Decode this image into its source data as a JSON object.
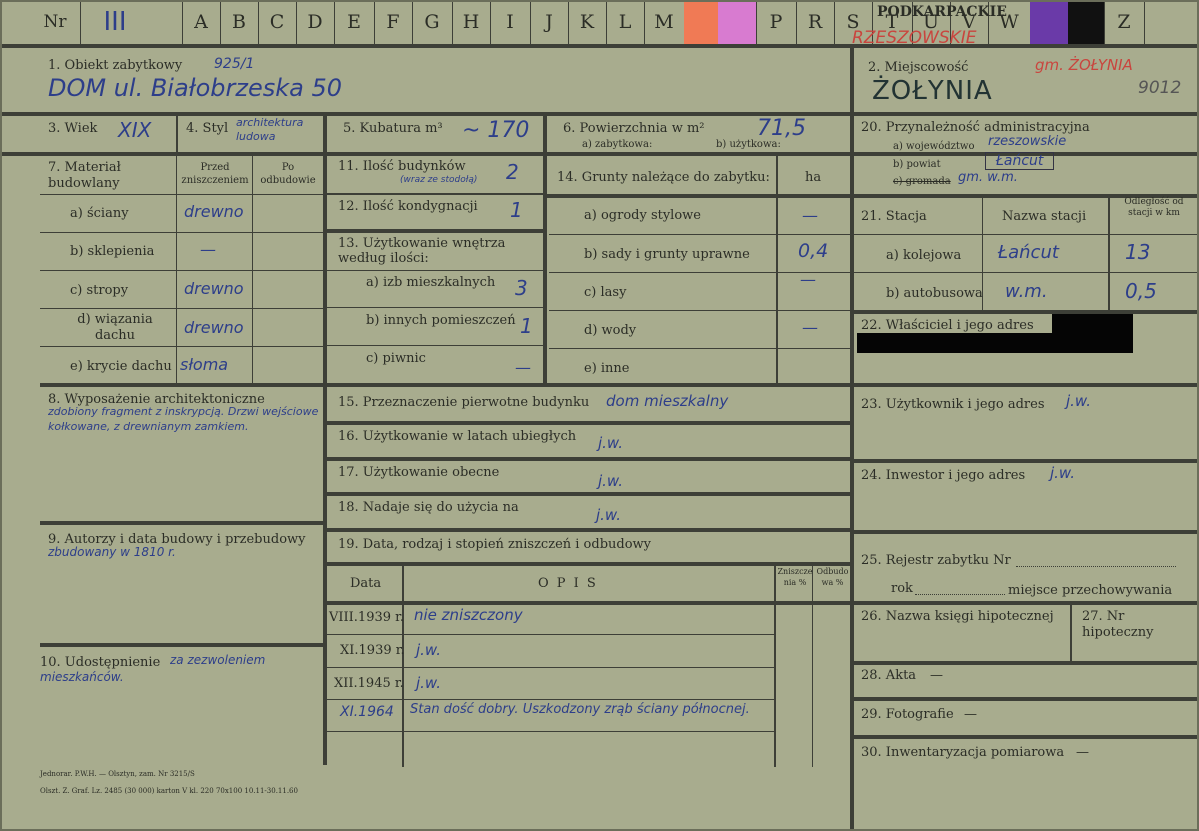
{
  "header": {
    "nr_label": "Nr",
    "nr_value": "III",
    "letters": [
      "A",
      "B",
      "C",
      "D",
      "E",
      "F",
      "G",
      "H",
      "I",
      "J",
      "K",
      "L",
      "M",
      "",
      "",
      "",
      "P",
      "R",
      "S",
      "T",
      "U",
      "V",
      "W",
      "",
      "",
      "Z"
    ],
    "region_print": "PODKARPACKIE",
    "region_stamp": "RZESZOWSKIE",
    "swatches": {
      "orange": "#f07a55",
      "pink": "#d87bd0",
      "purple": "#6a3aa8",
      "black": "#111111"
    }
  },
  "f1": {
    "label": "1. Obiekt zabytkowy",
    "note": "925/1",
    "value": "DOM ul. Białobrzeska 50"
  },
  "f2": {
    "label": "2. Miejscowość",
    "value": "ŻOŁYNIA",
    "stamp": "gm. ŻOŁYNIA",
    "code": "9012"
  },
  "f3": {
    "label": "3. Wiek",
    "value": "XIX"
  },
  "f4": {
    "label": "4. Styl",
    "value": "architektura ludowa"
  },
  "f5": {
    "label": "5. Kubatura m³",
    "value": "~ 170"
  },
  "f6": {
    "label": "6. Powierzchnia w m²",
    "sub_a": "a) zabytkowa:",
    "sub_b": "b) użytkowa:",
    "value": "71,5"
  },
  "f7": {
    "label": "7. Materiał budowlany",
    "col_before": "Przed zniszczeniem",
    "col_after": "Po odbudowie",
    "rows": [
      {
        "label": "a) ściany",
        "before": "drewno"
      },
      {
        "label": "b) sklepienia",
        "before": "—"
      },
      {
        "label": "c) stropy",
        "before": "drewno"
      },
      {
        "label": "d) wiązania dachu",
        "before": "drewno"
      },
      {
        "label": "e) krycie dachu",
        "before": "słoma"
      }
    ]
  },
  "f8": {
    "label": "8. Wyposażenie architektoniczne",
    "value": "zdobiony fragment z inskrypcją. Drzwi wejściowe kołkowane, z drewnianym zamkiem."
  },
  "f9": {
    "label": "9. Autorzy i data budowy i przebudowy",
    "value": "zbudowany w 1810 r."
  },
  "f10": {
    "label": "10. Udostępnienie",
    "value": "za zezwoleniem mieszkańców."
  },
  "f11": {
    "label": "11. Ilość budynków",
    "note": "(wraz ze stodołą)",
    "value": "2"
  },
  "f12": {
    "label": "12. Ilość kondygnacji",
    "value": "1"
  },
  "f13": {
    "label": "13. Użytkowanie wnętrza według ilości:",
    "rows": [
      {
        "label": "a) izb mieszkalnych",
        "value": "3"
      },
      {
        "label": "b) innych pomieszczeń",
        "value": "1"
      },
      {
        "label": "c) piwnic",
        "value": "—"
      }
    ]
  },
  "f14": {
    "label": "14. Grunty należące do zabytku:",
    "unit": "ha",
    "rows": [
      {
        "label": "a) ogrody stylowe",
        "value": "—"
      },
      {
        "label": "b) sady i grunty uprawne",
        "value": "0,4"
      },
      {
        "label": "c) lasy",
        "value": "—"
      },
      {
        "label": "d) wody",
        "value": "—"
      },
      {
        "label": "e) inne",
        "value": ""
      }
    ]
  },
  "f15": {
    "label": "15. Przeznaczenie pierwotne budynku",
    "value": "dom mieszkalny"
  },
  "f16": {
    "label": "16. Użytkowanie w latach ubiegłych",
    "value": "j.w."
  },
  "f17": {
    "label": "17. Użytkowanie obecne",
    "value": "j.w."
  },
  "f18": {
    "label": "18. Nadaje się do użycia na",
    "value": "j.w."
  },
  "f19": {
    "label": "19. Data, rodzaj i stopień zniszczeń i odbudowy",
    "col_date": "Data",
    "col_opis": "O P I S",
    "col_z": "Zniszczenia %",
    "col_o": "Odbudowa %",
    "rows": [
      {
        "date": "VIII.1939 r.",
        "opis": "nie zniszczony"
      },
      {
        "date": "XI.1939 r.",
        "opis": "j.w."
      },
      {
        "date": "XII.1945 r.",
        "opis": "j.w."
      },
      {
        "date": "XI.1964",
        "opis": "Stan dość dobry. Uszkodzony zrąb ściany północnej."
      }
    ]
  },
  "f20": {
    "label": "20. Przynależność administracyjna",
    "a_label": "a) województwo",
    "a_value": "rzeszowskie",
    "b_label": "b) powiat",
    "b_value": "Łańcut",
    "c_label": "c) gromada",
    "c_value": "gm. w.m."
  },
  "f21": {
    "label": "21. Stacja",
    "col_name": "Nazwa stacji",
    "col_dist": "Odległość od stacji w km",
    "rows": [
      {
        "label": "a) kolejowa",
        "name": "Łańcut",
        "dist": "13"
      },
      {
        "label": "b) autobusowa",
        "name": "w.m.",
        "dist": "0,5"
      }
    ]
  },
  "f22": {
    "label": "22. Właściciel i jego adres"
  },
  "f23": {
    "label": "23. Użytkownik i jego adres",
    "value": "j.w."
  },
  "f24": {
    "label": "24. Inwestor i jego adres",
    "value": "j.w."
  },
  "f25": {
    "label": "25. Rejestr zabytku Nr",
    "rok": "rok",
    "miejsce": "miejsce przechowywania"
  },
  "f26": {
    "label": "26. Nazwa księgi hipotecznej"
  },
  "f27": {
    "label": "27. Nr hipoteczny"
  },
  "f28": {
    "label": "28. Akta",
    "value": "—"
  },
  "f29": {
    "label": "29. Fotografie",
    "value": "—"
  },
  "f30": {
    "label": "30. Inwentaryzacja pomiarowa",
    "value": "—"
  },
  "footer": {
    "line1": "Jednorar. P.W.H. — Olsztyn, zam. Nr 3215/S",
    "line2": "Olszt. Z. Graf. Lz. 2485 (30 000) karton V kl. 220 70x100 10.11-30.11.60"
  }
}
